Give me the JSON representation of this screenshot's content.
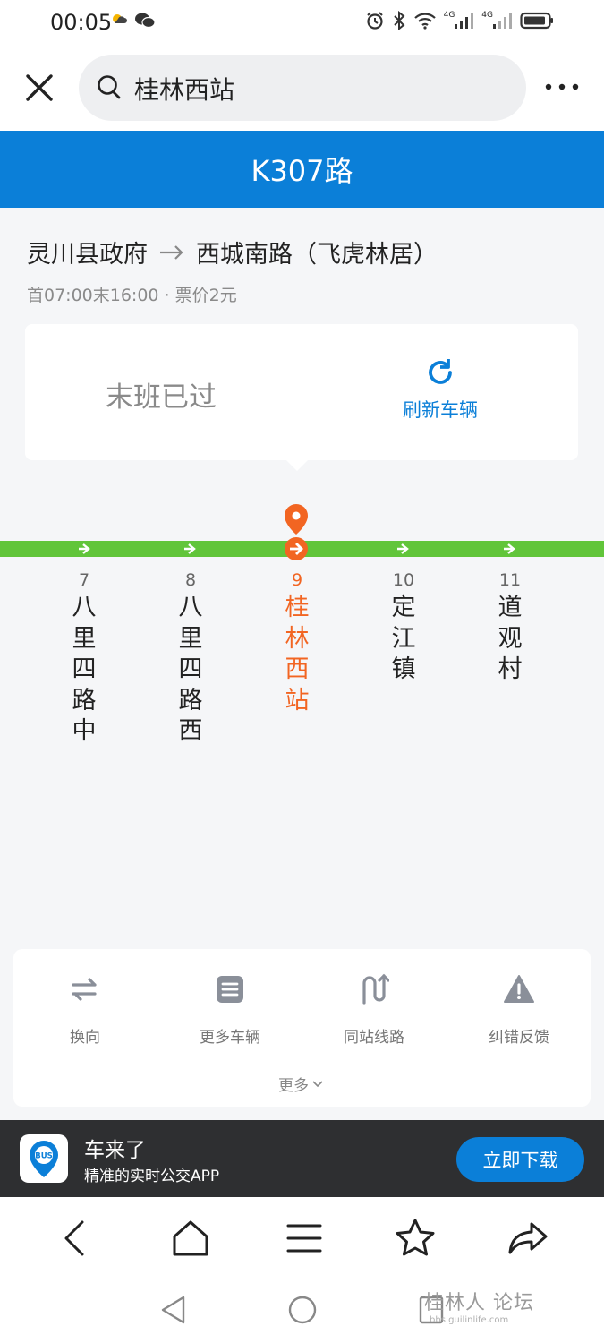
{
  "status_bar": {
    "time": "00:05",
    "network_1": "4G",
    "network_2": "4G"
  },
  "search": {
    "query": "桂林西站"
  },
  "route": {
    "title": "K307路",
    "from": "灵川县政府",
    "to": "西城南路（飞虎林居）",
    "meta": "首07:00末16:00 · 票价2元"
  },
  "status_card": {
    "message": "末班已过",
    "refresh_label": "刷新车辆"
  },
  "timeline": {
    "line_color": "#61c53a",
    "active_color": "#f26522",
    "stops": [
      {
        "num": "7",
        "name": "八里四路中",
        "active": false
      },
      {
        "num": "8",
        "name": "八里四路西",
        "active": false
      },
      {
        "num": "9",
        "name": "桂林西站",
        "active": true
      },
      {
        "num": "10",
        "name": "定江镇",
        "active": false
      },
      {
        "num": "11",
        "name": "道观村",
        "active": false
      }
    ]
  },
  "actions": {
    "items": [
      {
        "label": "换向",
        "icon": "swap-icon"
      },
      {
        "label": "更多车辆",
        "icon": "list-icon"
      },
      {
        "label": "同站线路",
        "icon": "route-icon"
      },
      {
        "label": "纠错反馈",
        "icon": "warning-icon"
      }
    ],
    "more_label": "更多"
  },
  "app_banner": {
    "logo_text": "BUS",
    "name": "车来了",
    "desc": "精准的实时公交APP",
    "download_label": "立即下载"
  },
  "watermark": {
    "text": "桂林人 论坛",
    "sub": "bbs.guilinlife.com"
  },
  "colors": {
    "brand_blue": "#0b7fd8",
    "line_green": "#61c53a",
    "active_orange": "#f26522"
  }
}
